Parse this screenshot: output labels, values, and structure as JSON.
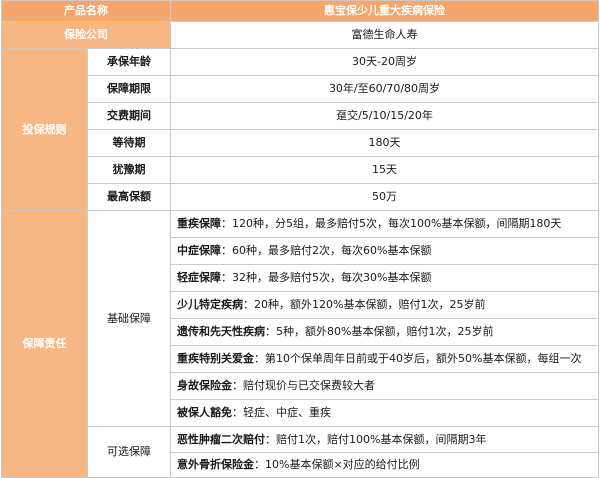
{
  "header": {
    "product_label": "产品名称",
    "product_value": "惠宝保少儿重大疾病保险"
  },
  "company": {
    "label": "保险公司",
    "value": "富德生命人寿"
  },
  "rules": {
    "category": "投保规则",
    "rows": [
      {
        "label": "承保年龄",
        "value": "30天-20周岁"
      },
      {
        "label": "保障期限",
        "value": "30年/至60/70/80周岁"
      },
      {
        "label": "交费期间",
        "value": "趸交/5/10/15/20年"
      },
      {
        "label": "等待期",
        "value": "180天"
      },
      {
        "label": "犹豫期",
        "value": "15天"
      },
      {
        "label": "最高保额",
        "value": "50万"
      }
    ]
  },
  "coverage": {
    "category": "保障责任",
    "basic": {
      "label": "基础保障",
      "items": [
        {
          "name": "重疾保障",
          "sep": "：",
          "desc": "120种，分5组，最多赔付5次，每次100%基本保额，间隔期180天"
        },
        {
          "name": "中症保障",
          "sep": "：",
          "desc": "60种，最多赔付2次，每次60%基本保额"
        },
        {
          "name": "轻症保障",
          "sep": "：",
          "desc": "32种，最多赔付5次，每次30%基本保额"
        },
        {
          "name": "少儿特定疾病",
          "sep": "：",
          "desc": "20种，额外120%基本保额，赔付1次，25岁前"
        },
        {
          "name": "遗传和先天性疾病",
          "sep": "：",
          "desc": "5种，额外80%基本保额，赔付1次，25岁前"
        },
        {
          "name": "重疾特别关爱金",
          "sep": "：",
          "desc": "第10个保单周年日前或于40岁后，额外50%基本保额，每组一次"
        },
        {
          "name": "身故保险金",
          "sep": "：",
          "desc": "赔付现价与已交保费较大者"
        },
        {
          "name": "被保人豁免",
          "sep": "：",
          "desc": "轻症、中症、重疾"
        }
      ]
    },
    "optional": {
      "label": "可选保障",
      "items": [
        {
          "name": "恶性肿瘤二次赔付",
          "sep": "：",
          "desc": "赔付1次，赔付100%基本保额，间隔期3年"
        },
        {
          "name": "意外骨折保险金",
          "sep": "：",
          "desc": "10%基本保额×对应的给付比例"
        }
      ]
    }
  }
}
